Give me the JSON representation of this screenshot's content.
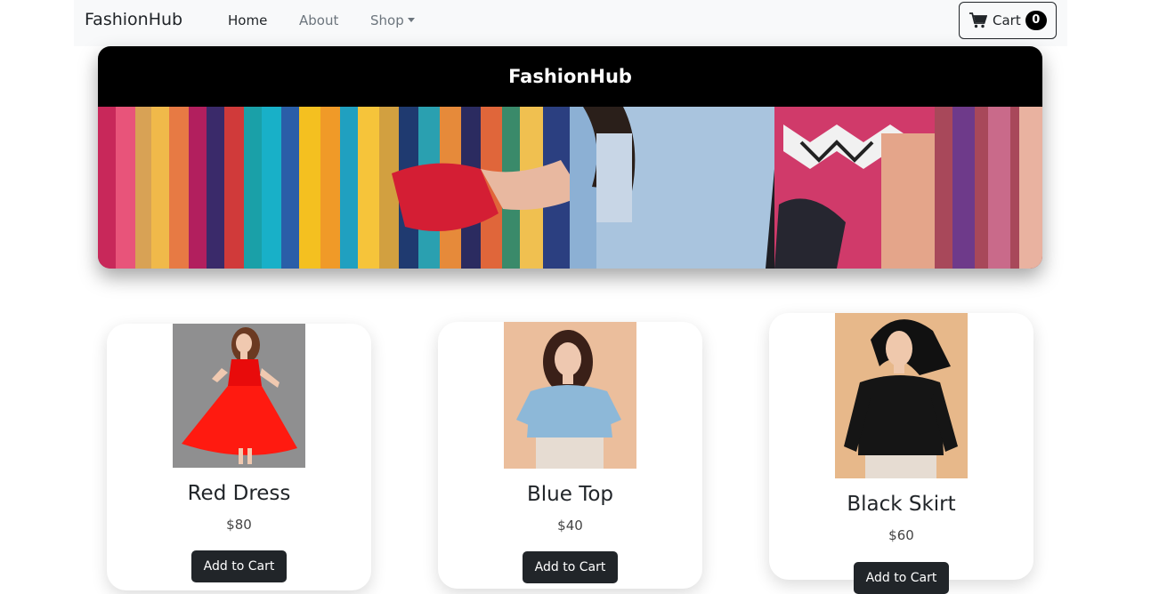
{
  "navbar": {
    "brand": "FashionHub",
    "links": [
      {
        "label": "Home",
        "active": true
      },
      {
        "label": "About",
        "active": false
      },
      {
        "label": "Shop",
        "active": false
      }
    ],
    "cart": {
      "label": "Cart",
      "count": "0",
      "icon": "cart-icon"
    }
  },
  "hero": {
    "title": "FashionHub",
    "image": "clothing-rack-shopping-image"
  },
  "products": [
    {
      "name": "Red Dress",
      "price": "$80",
      "image": "red-dress-image",
      "button": "Add to Cart"
    },
    {
      "name": "Blue Top",
      "price": "$40",
      "image": "blue-top-image",
      "button": "Add to Cart"
    },
    {
      "name": "Black Skirt",
      "price": "$60",
      "image": "black-skirt-image",
      "button": "Add to Cart"
    }
  ],
  "colors": {
    "navbar_bg": "#f8f9fa",
    "hero_header_bg": "#000000",
    "button_dark": "#212529",
    "text": "#212529",
    "muted": "#6c757d"
  }
}
